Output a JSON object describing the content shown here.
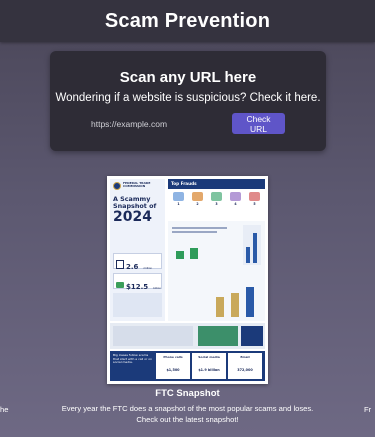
{
  "header": {
    "title": "Scam Prevention"
  },
  "scan": {
    "title": "Scan any URL here",
    "subtitle": "Wondering if a website is suspicious? Check it here.",
    "url_placeholder": "https://example.com",
    "button_label": "Check URL"
  },
  "carousel": {
    "prev_label_fragment": "he",
    "next_label_fragment": "Fr",
    "card": {
      "title": "FTC Snapshot",
      "description": "Every year the FTC does a snapshot of the most popular scams and loses. Check out the latest snapshot!",
      "infographic": {
        "agency": "FEDERAL TRADE COMMISSION",
        "headline": "A Scammy Snapshot of",
        "year": "2024",
        "fraud_reports_value": "2.6",
        "fraud_reports_unit": "million",
        "fraud_reports_label": "fraud reports",
        "losses_value": "$12.5",
        "losses_unit": "billion",
        "losses_label": "reported lost",
        "top_frauds_title": "Top Frauds",
        "top_frauds": [
          {
            "rank": "1",
            "color": "#8fb4e3"
          },
          {
            "rank": "2",
            "color": "#e3a86b"
          },
          {
            "rank": "3",
            "color": "#7fc4a0"
          },
          {
            "rank": "4",
            "color": "#b49ad6"
          },
          {
            "rank": "5",
            "color": "#e08a8a"
          }
        ],
        "investment_bars": [
          {
            "label": "2022",
            "value": 3.8
          },
          {
            "label": "2023",
            "value": 4.6
          },
          {
            "label": "2024",
            "value": 5.7
          }
        ],
        "bottom_items": [
          "Phone calls",
          "Social media",
          "Email"
        ],
        "bottom_values": [
          "$1,500",
          "$1.9 billion",
          "372,000"
        ],
        "big_losses_text": "Big losses follow scams that start with a call or on social media."
      }
    }
  }
}
